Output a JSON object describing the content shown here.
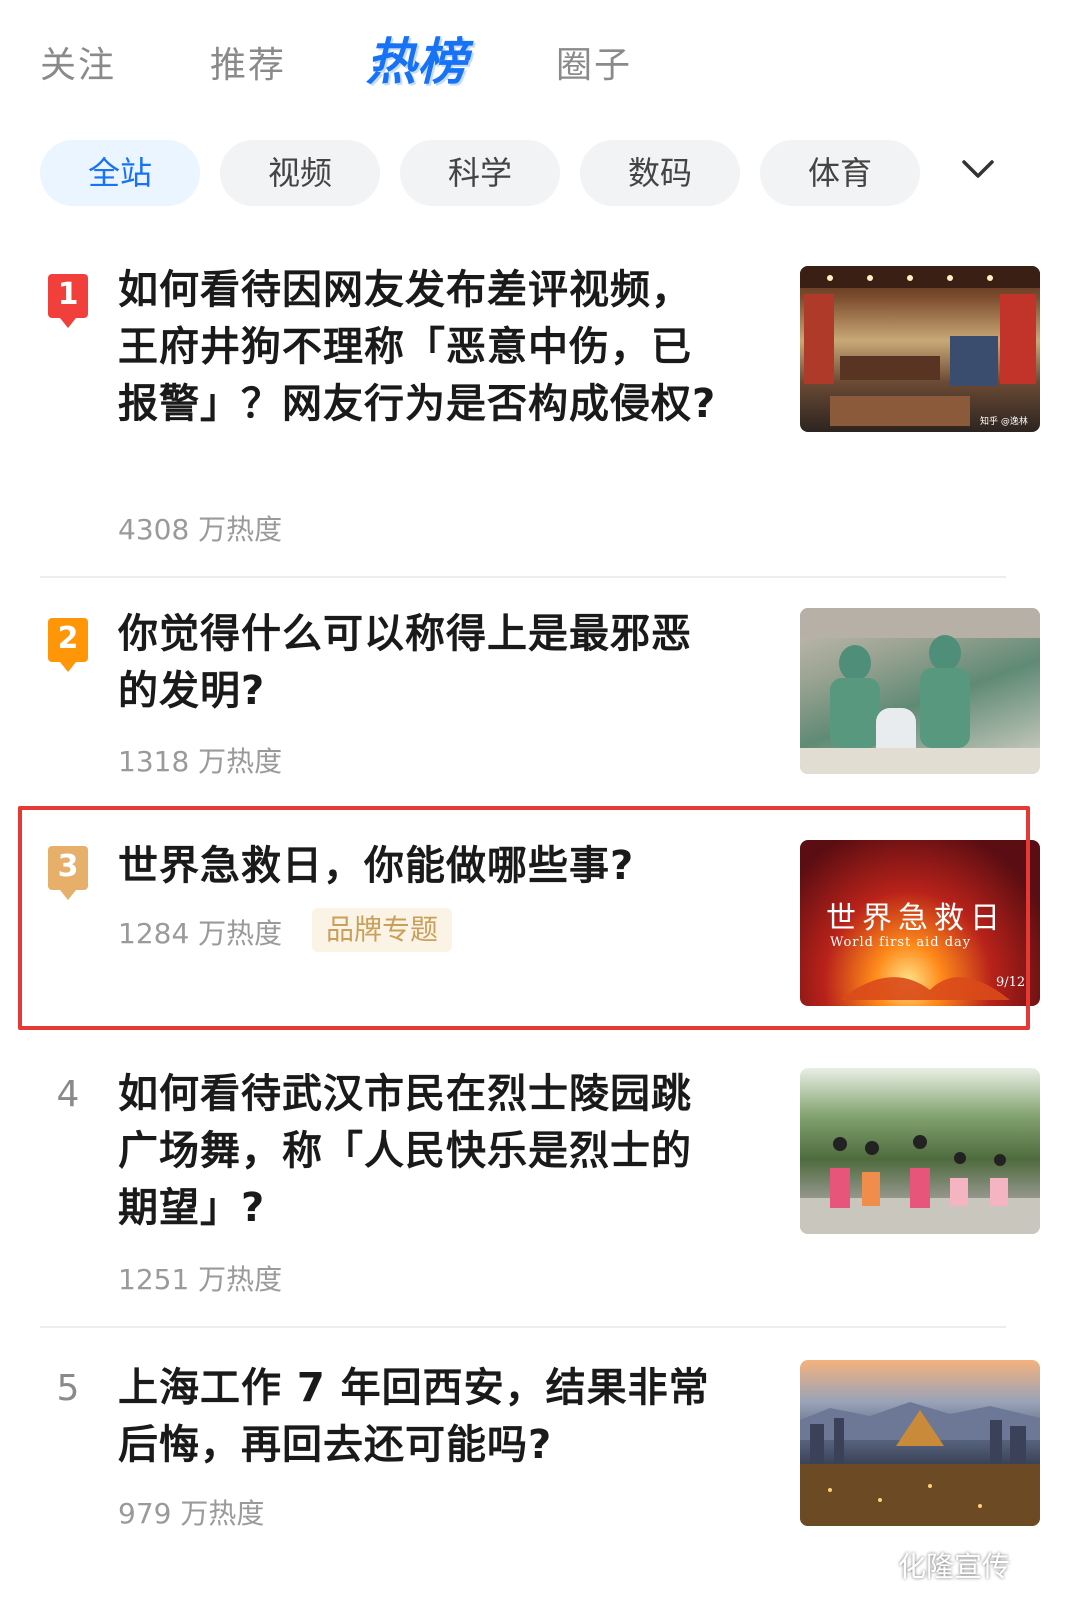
{
  "top_tabs": [
    "关注",
    "推荐",
    "热榜",
    "圈子"
  ],
  "active_top_tab": "热榜",
  "chips": [
    "全站",
    "视频",
    "科学",
    "数码",
    "体育"
  ],
  "items": [
    {
      "rank": "1",
      "title": "如何看待因网友发布差评视频，王府井狗不理称「恶意中伤，已报警」？网友行为是否构成侵权?",
      "heat": "4308 万热度",
      "thumb_watermark": "知乎 @逸林"
    },
    {
      "rank": "2",
      "title": "你觉得什么可以称得上是最邪恶的发明?",
      "heat": "1318 万热度"
    },
    {
      "rank": "3",
      "title": "世界急救日，你能做哪些事?",
      "heat": "1284 万热度",
      "badge": "品牌专题",
      "thumb_text": "世界急救日",
      "thumb_subtext": "World first aid day",
      "thumb_date": "9/12"
    },
    {
      "rank": "4",
      "title": "如何看待武汉市民在烈士陵园跳广场舞，称「人民快乐是烈士的期望」?",
      "heat": "1251 万热度"
    },
    {
      "rank": "5",
      "title": "上海工作 7 年回西安，结果非常后悔，再回去还可能吗?",
      "heat": "979 万热度"
    }
  ],
  "watermark": "化隆宣传",
  "colors": {
    "accent": "#1772f6",
    "rank1": "#f1403c",
    "rank2": "#ff9607",
    "rank3": "#e6b06b",
    "highlight_frame": "#e53935"
  }
}
